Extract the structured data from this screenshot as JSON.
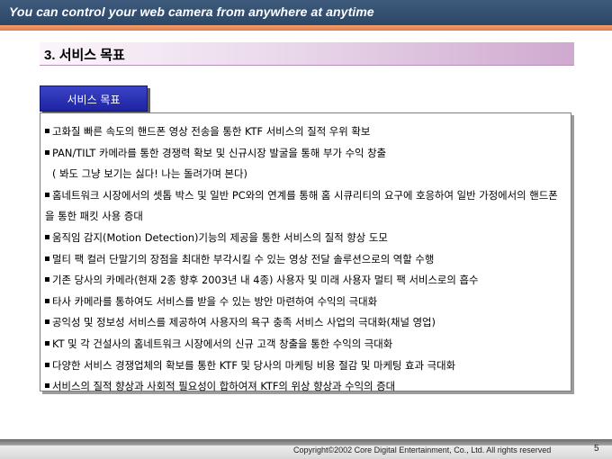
{
  "header": {
    "tagline": "You can control your web camera  from anywhere at anytime"
  },
  "section": {
    "number": "3.",
    "title": "서비스 목표"
  },
  "tab": {
    "label": "서비스 목표"
  },
  "items": [
    {
      "text": "고화질 빠른 속도의 핸드폰 영상 전송을 통한 KTF 서비스의 질적 우위 확보",
      "bullet": true
    },
    {
      "text": "PAN/TILT 카메라를 통한 경쟁력 확보 및 신규시장 발굴을 통해 부가 수익 창출",
      "bullet": true
    },
    {
      "text": "( 봐도 그냥 보기는 싫다!  나는 돌려가며 본다)",
      "bullet": false
    },
    {
      "text": "홈네트워크 시장에서의 셋톱 박스 및 일반 PC와의 연계를 통해 홈 시큐리티의 요구에 호응하여 일반 가정에서의 핸드폰을 통한 패킷 사용 증대",
      "bullet": true
    },
    {
      "text": "움직임 감지(Motion Detection)기능의 제공을 통한 서비스의 질적 향상 도모",
      "bullet": true
    },
    {
      "text": "멀티 팩 컬러 단말기의 장점을 최대한 부각시킬 수 있는 영상 전달 솔루션으로의 역할 수행",
      "bullet": true
    },
    {
      "text": "기존 당사의 카메라(현재 2종 향후 2003년 내 4종) 사용자 및 미래 사용자 멀티 팩 서비스로의 흡수",
      "bullet": true
    },
    {
      "text": "타사 카메라를 통하여도 서비스를 받을 수 있는 방안 마련하여 수익의 극대화",
      "bullet": true
    },
    {
      "text": "공익성 및 정보성 서비스를 제공하여 사용자의 욕구 충족 서비스 사업의 극대화(채널 영업)",
      "bullet": true
    },
    {
      "text": "KT 및 각 건설사의 홈네트워크 시장에서의 신규 고객 창출을 통한 수익의 극대화",
      "bullet": true
    },
    {
      "text": "다양한 서비스 경쟁업체의 확보를 통한 KTF 및 당사의 마케팅 비용 절감 및 마케팅 효과 극대화",
      "bullet": true
    },
    {
      "text": "서비스의 질적 향상과 사회적 필요성이 합하여져 KTF의 위상 향상과 수익의 증대",
      "bullet": true
    }
  ],
  "footer": {
    "copyright": "Copyright©2002 Core Digital Entertainment, Co., Ltd. All rights reserved",
    "page": "5"
  },
  "colors": {
    "header_bg": "#2c4766",
    "accent_orange": "#e07a45",
    "tab_bg": "#1e23a0",
    "title_gradient_end": "#cfa9d0"
  }
}
